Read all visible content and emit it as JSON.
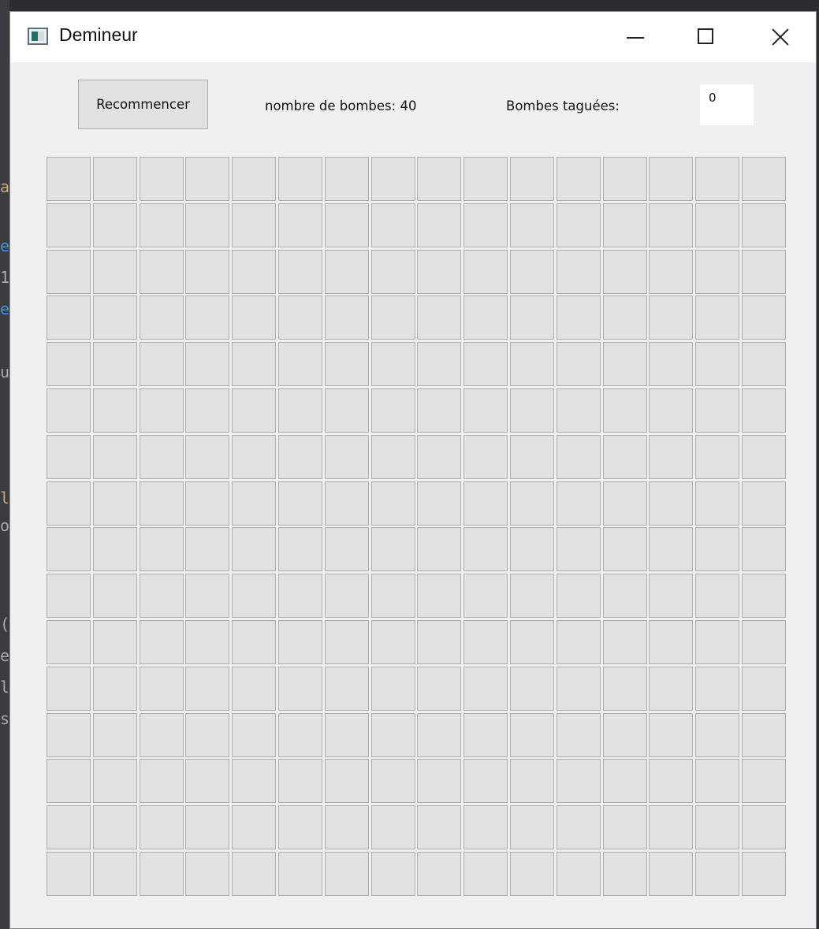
{
  "window": {
    "title": "Demineur",
    "icon": "app-window-icon",
    "controls": [
      "minimize-icon",
      "maximize-icon",
      "close-icon"
    ]
  },
  "toolbar": {
    "restart_label": "Recommencer",
    "bombs_label": "nombre de bombes: 40",
    "tagged_label": "Bombes taguées:",
    "tagged_value": "0"
  },
  "board": {
    "rows": 16,
    "cols": 16,
    "cell_state": "unrevealed",
    "cell_color": "#e1e1e1",
    "border_color": "#adadad"
  },
  "colors": {
    "window_bg": "#f0f0f0",
    "titlebar_bg": "#ffffff"
  }
}
